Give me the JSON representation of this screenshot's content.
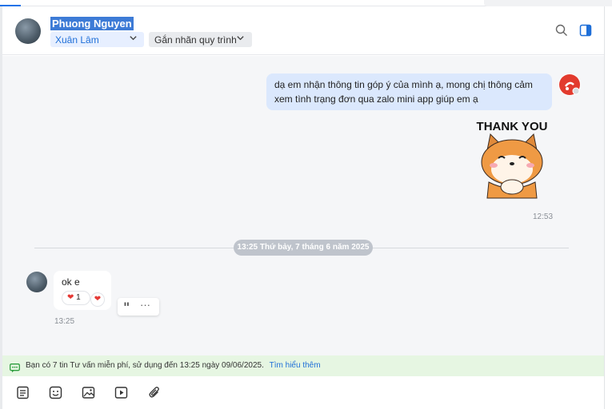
{
  "header": {
    "contact_name": "Phuong Nguyen",
    "assignee": "Xuân Lâm",
    "label_placeholder": "Gắn nhãn quy trình",
    "icons": [
      "search-icon",
      "side-panel-icon"
    ]
  },
  "messages": {
    "outgoing_text": "dạ em nhận thông tin góp ý của mình ạ, mong chị thông cảm xem tình trạng đơn qua zalo mini app giúp em ạ",
    "sticker_text": "THANK YOU",
    "outgoing_time": "12:53",
    "date_separator": "13:25 Thứ bảy, 7 tháng 6 năm 2025",
    "incoming_text": "ok e",
    "reaction_emoji": "❤",
    "reaction_count": "1",
    "incoming_time": "13:25"
  },
  "notice": {
    "text": "Bạn có 7 tin Tư vấn miễn phí, sử dụng đến 13:25 ngày 09/06/2025.",
    "link": "Tìm hiểu thêm"
  },
  "toolbar": {
    "icons": [
      "note-icon",
      "sticker-icon",
      "image-icon",
      "video-icon",
      "attachment-icon"
    ]
  },
  "colors": {
    "accent": "#1f6fd8",
    "outgoing_bubble": "#dbe8fd",
    "notice_bg": "#e6f6e2",
    "chat_bg": "#f5f6f8"
  }
}
